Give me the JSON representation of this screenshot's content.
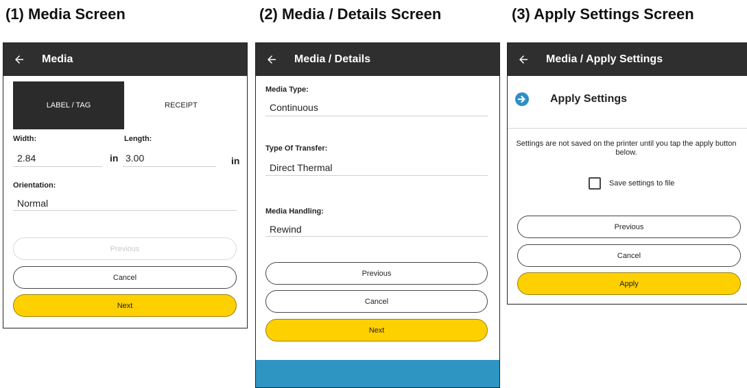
{
  "captions": {
    "c1": "(1) Media Screen",
    "c2": "(2) Media / Details Screen",
    "c3": "(3) Apply Settings Screen"
  },
  "screen1": {
    "title": "Media",
    "tabs": {
      "label_tag": "LABEL / TAG",
      "receipt": "RECEIPT",
      "active": "label_tag"
    },
    "width_label": "Width:",
    "width_value": "2.84",
    "width_unit": "in",
    "length_label": "Length:",
    "length_value": "3.00",
    "length_unit": "in",
    "orientation_label": "Orientation:",
    "orientation_value": "Normal",
    "buttons": {
      "previous": "Previous",
      "cancel": "Cancel",
      "next": "Next"
    }
  },
  "screen2": {
    "title": "Media / Details",
    "media_type_label": "Media Type:",
    "media_type_value": "Continuous",
    "transfer_label": "Type Of Transfer:",
    "transfer_value": "Direct Thermal",
    "handling_label": "Media Handling:",
    "handling_value": "Rewind",
    "buttons": {
      "previous": "Previous",
      "cancel": "Cancel",
      "next": "Next"
    }
  },
  "screen3": {
    "title": "Media / Apply Settings",
    "heading": "Apply Settings",
    "info": "Settings are not saved on the printer until you tap the apply button below.",
    "checkbox_label": "Save settings to file",
    "checkbox_checked": false,
    "buttons": {
      "previous": "Previous",
      "cancel": "Cancel",
      "apply": "Apply"
    }
  },
  "colors": {
    "appbar": "#2f2f2f",
    "accent_yellow": "#ffd000",
    "blue_bar": "#2e95c2",
    "arrow_icon": "#2e8fc6"
  }
}
